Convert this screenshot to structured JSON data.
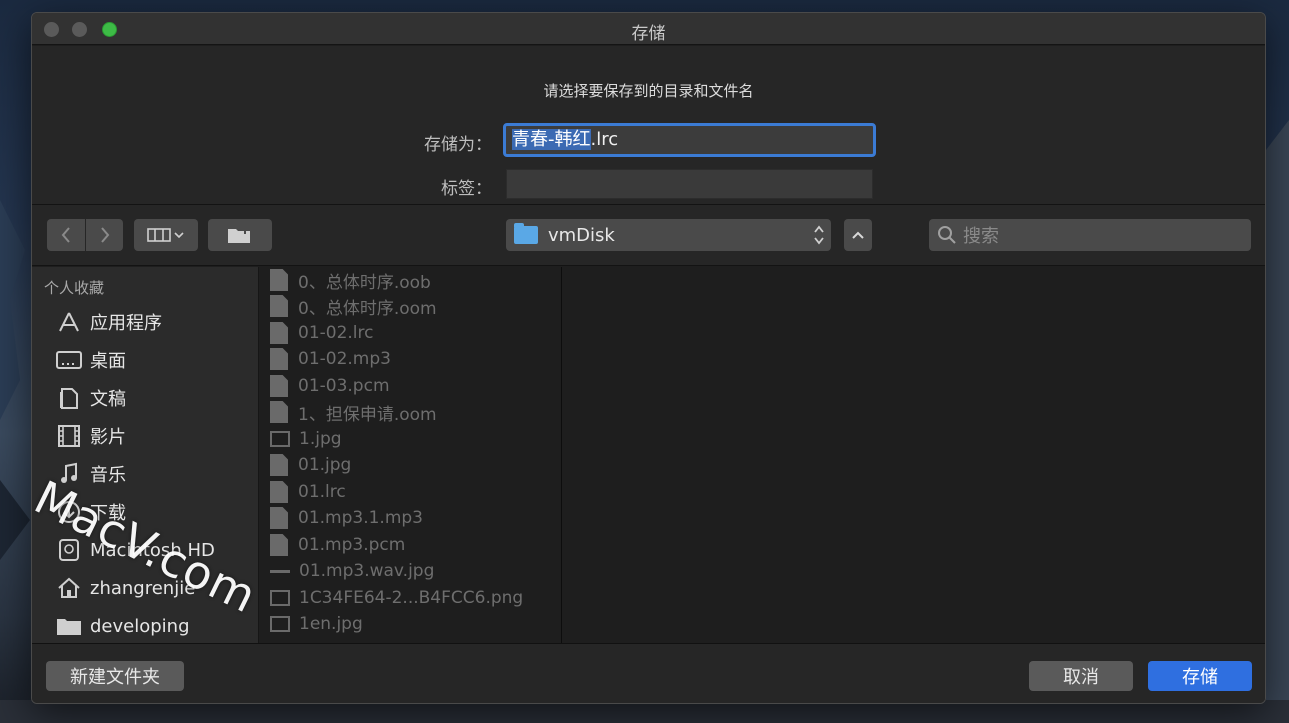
{
  "window": {
    "title": "存储",
    "prompt": "请选择要保存到的目录和文件名"
  },
  "form": {
    "save_as_label": "存储为：",
    "filename_selected": "青春-韩红",
    "filename_ext": ".lrc",
    "tags_label": "标签："
  },
  "toolbar": {
    "location": "vmDisk",
    "search_placeholder": "搜索"
  },
  "sidebar": {
    "heading": "个人收藏",
    "items": [
      {
        "label": "应用程序",
        "icon": "applications-icon"
      },
      {
        "label": "桌面",
        "icon": "desktop-icon"
      },
      {
        "label": "文稿",
        "icon": "documents-icon"
      },
      {
        "label": "影片",
        "icon": "movies-icon"
      },
      {
        "label": "音乐",
        "icon": "music-icon"
      },
      {
        "label": "下载",
        "icon": "downloads-icon"
      },
      {
        "label": "Macintosh HD",
        "icon": "disk-icon"
      },
      {
        "label": "zhangrenjie",
        "icon": "home-icon"
      },
      {
        "label": "developing",
        "icon": "folder-icon"
      }
    ]
  },
  "files": [
    {
      "name": "0、总体时序.oob",
      "kind": "doc"
    },
    {
      "name": "0、总体时序.oom",
      "kind": "doc"
    },
    {
      "name": "01-02.lrc",
      "kind": "doc"
    },
    {
      "name": "01-02.mp3",
      "kind": "doc"
    },
    {
      "name": "01-03.pcm",
      "kind": "doc"
    },
    {
      "name": "1、担保申请.oom",
      "kind": "doc"
    },
    {
      "name": "1.jpg",
      "kind": "img"
    },
    {
      "name": "01.jpg",
      "kind": "doc"
    },
    {
      "name": "01.lrc",
      "kind": "doc"
    },
    {
      "name": "01.mp3.1.mp3",
      "kind": "doc"
    },
    {
      "name": "01.mp3.pcm",
      "kind": "doc"
    },
    {
      "name": "01.mp3.wav.jpg",
      "kind": "line"
    },
    {
      "name": "1C34FE64-2...B4FCC6.png",
      "kind": "img"
    },
    {
      "name": "1en.jpg",
      "kind": "img"
    }
  ],
  "footer": {
    "new_folder": "新建文件夹",
    "cancel": "取消",
    "save": "存储"
  },
  "watermark": "MacV.com",
  "colors": {
    "accent": "#2f6fe0",
    "focus_ring": "#3b7bd4",
    "folder": "#5aa8e6"
  }
}
